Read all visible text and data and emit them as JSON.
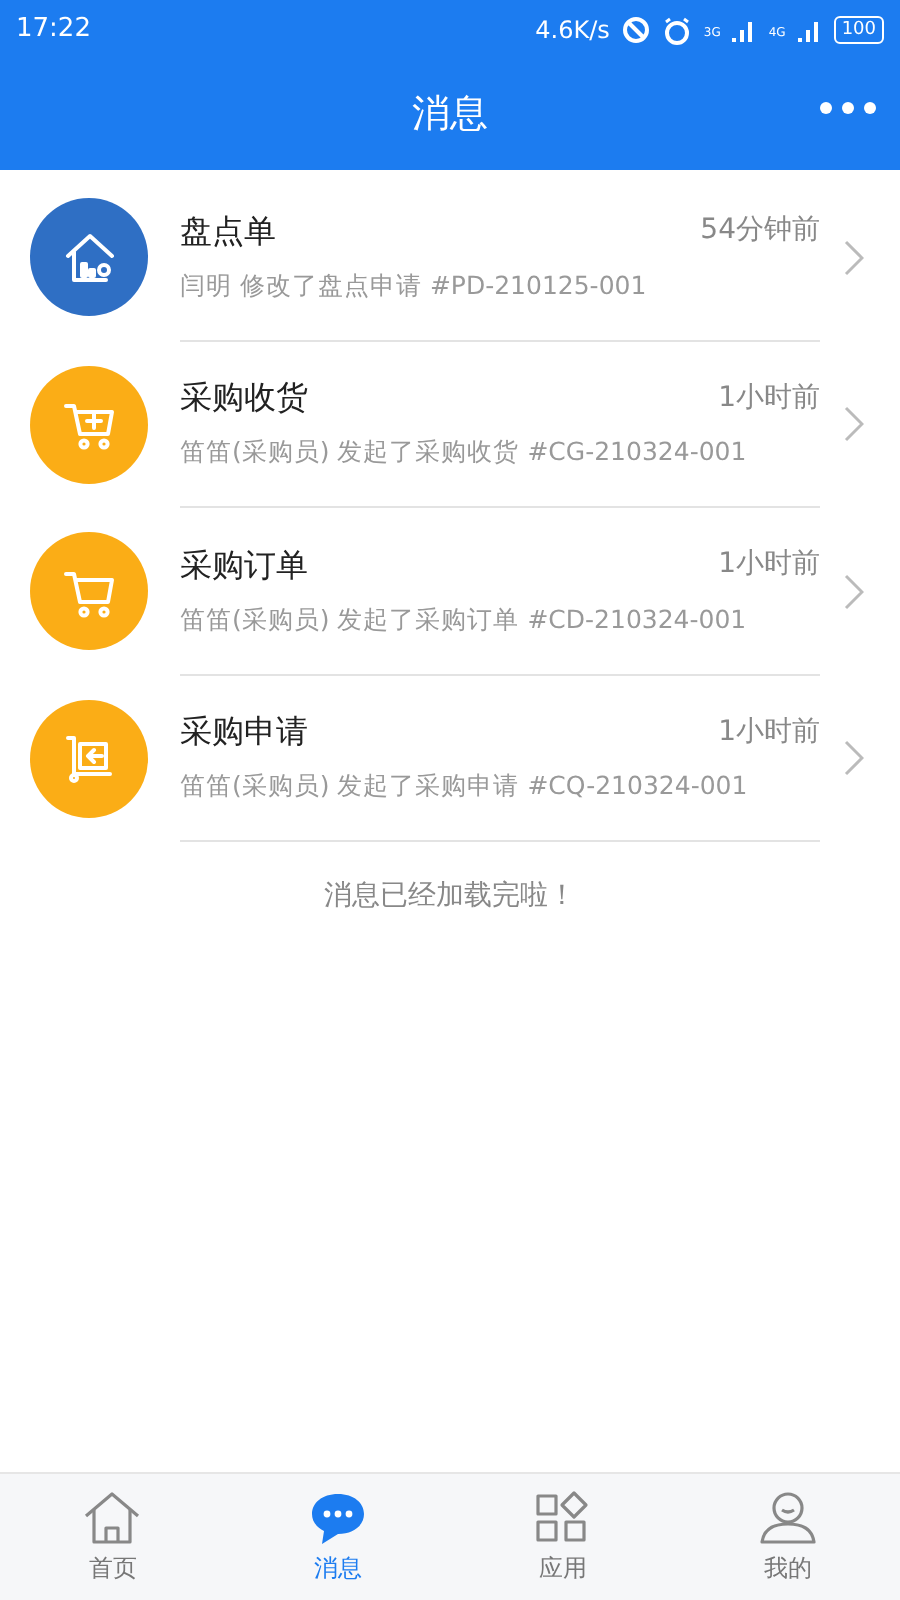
{
  "status_bar": {
    "time": "17:22",
    "speed": "4.6K/s",
    "network_1": "3G",
    "network_2": "4G",
    "battery": "100"
  },
  "header": {
    "title": "消息"
  },
  "messages": [
    {
      "kind": "inventory",
      "color": "#2f6fc4",
      "title": "盘点单",
      "time": "54分钟前",
      "detail": "闫明 修改了盘点申请 #PD-210125-001"
    },
    {
      "kind": "receive",
      "color": "#fbad16",
      "title": "采购收货",
      "time": "1小时前",
      "detail": "笛笛(采购员) 发起了采购收货 #CG-210324-001"
    },
    {
      "kind": "order",
      "color": "#fbad16",
      "title": "采购订单",
      "time": "1小时前",
      "detail": "笛笛(采购员) 发起了采购订单 #CD-210324-001"
    },
    {
      "kind": "request",
      "color": "#fbad16",
      "title": "采购申请",
      "time": "1小时前",
      "detail": "笛笛(采购员) 发起了采购申请 #CQ-210324-001"
    }
  ],
  "end_note": "消息已经加载完啦！",
  "tabs": [
    {
      "kind": "home",
      "label": "首页",
      "selected": false
    },
    {
      "kind": "message",
      "label": "消息",
      "selected": true
    },
    {
      "kind": "apps",
      "label": "应用",
      "selected": false
    },
    {
      "kind": "me",
      "label": "我的",
      "selected": false
    }
  ]
}
